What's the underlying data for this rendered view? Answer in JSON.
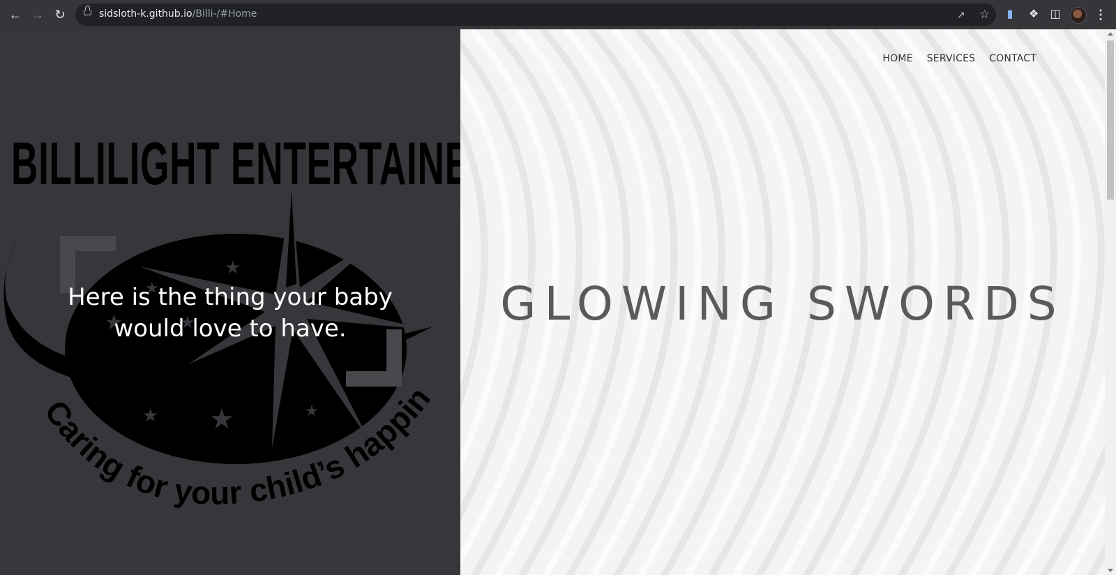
{
  "browser": {
    "url_host": "sidsloth-k.github.io",
    "url_path": "/Billi-/#Home",
    "icons": [
      "back-icon",
      "forward-icon",
      "reload-icon",
      "lock-icon",
      "share-icon",
      "bookmark-star-icon",
      "extension-doc-icon",
      "puzzle-icon",
      "side-panel-icon",
      "profile-avatar",
      "menu-dots-icon"
    ]
  },
  "left_panel": {
    "brand": "BILLILIGHT ENTERTAINERS",
    "logo_tagline": "Caring for your child’s happiness",
    "hero_text": "Here is the thing your baby would love to have."
  },
  "nav": {
    "items": [
      {
        "label": "HOME"
      },
      {
        "label": "SERVICES"
      },
      {
        "label": "CONTACT"
      }
    ]
  },
  "right_panel": {
    "hero_title": "GLOWING SWORDS"
  },
  "colors": {
    "left_bg": "#38353b",
    "right_bg": "#f4f4f4",
    "title_text": "#5a5a5a",
    "chrome_bg": "#35363a"
  }
}
